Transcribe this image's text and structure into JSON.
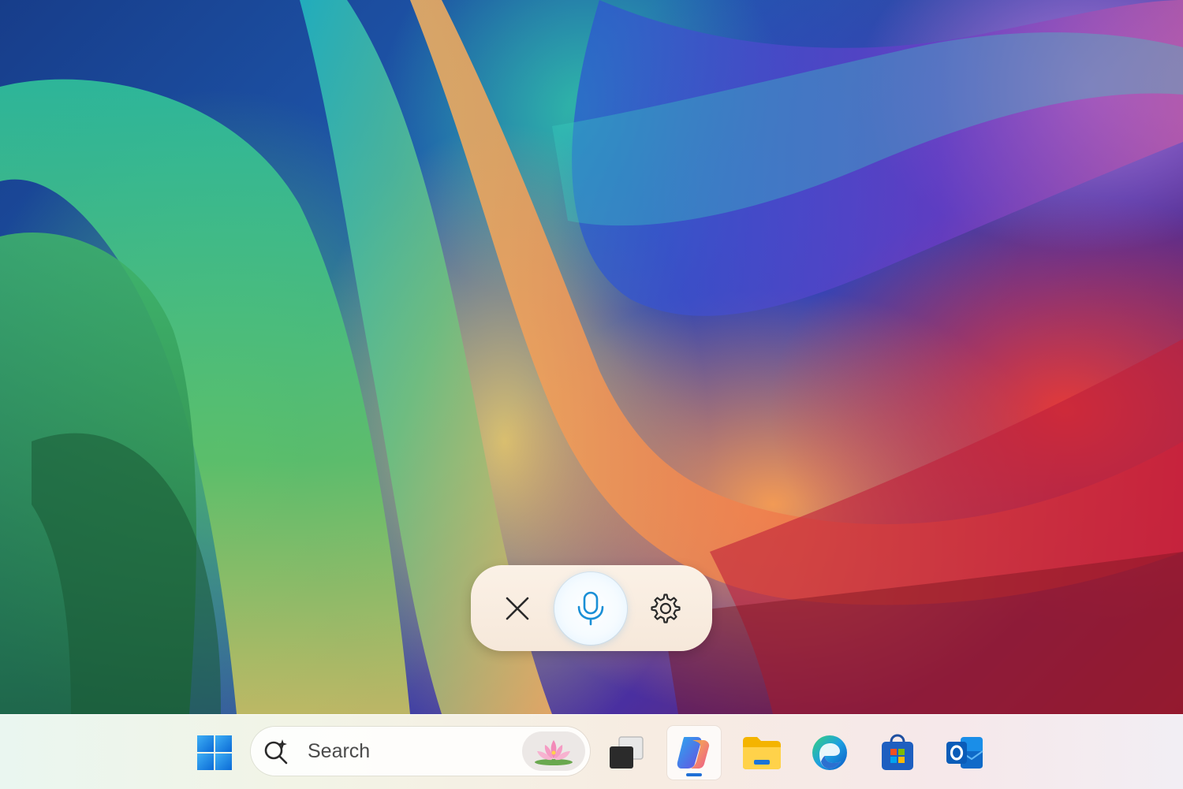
{
  "wallpaper": {
    "name": "colorful-ribbon-wallpaper"
  },
  "voice_bar": {
    "close_icon": "close-icon",
    "mic_icon": "microphone-icon",
    "settings_icon": "gear-icon",
    "mic_color": "#1a8fd6"
  },
  "taskbar": {
    "search": {
      "placeholder": "Search",
      "highlight_icon": "lotus-icon"
    },
    "apps": [
      {
        "name": "start",
        "icon": "windows-logo-icon"
      },
      {
        "name": "task-view",
        "icon": "task-view-icon"
      },
      {
        "name": "copilot",
        "icon": "copilot-icon",
        "active": true
      },
      {
        "name": "file-explorer",
        "icon": "folder-icon"
      },
      {
        "name": "edge",
        "icon": "edge-icon"
      },
      {
        "name": "microsoft-store",
        "icon": "store-icon"
      },
      {
        "name": "outlook",
        "icon": "outlook-icon"
      }
    ],
    "accent": "#1f6fd6"
  }
}
